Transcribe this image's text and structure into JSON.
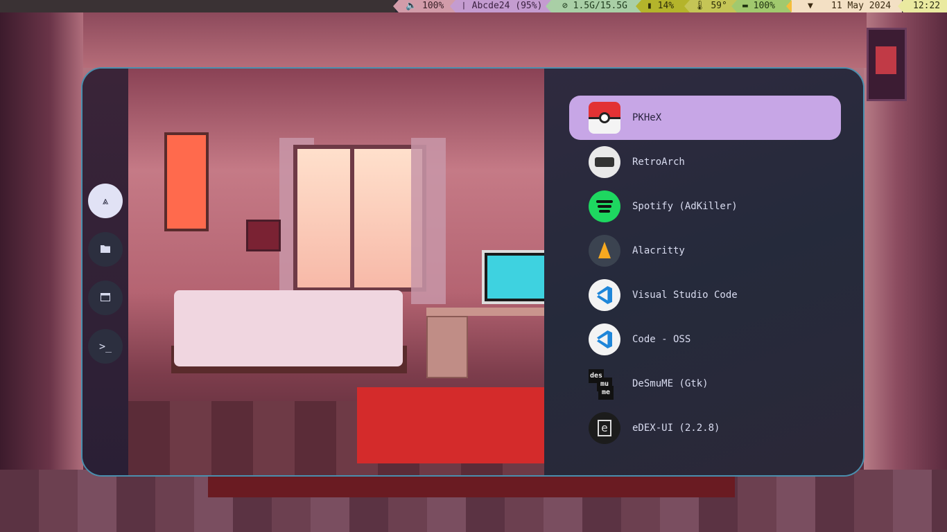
{
  "statusbar": {
    "volume": "🔈 100%",
    "wifi": "❘ Abcde24 (95%)",
    "memory": "⊘ 1.5G/15.5G",
    "cpu": "▮ 14%",
    "temperature": "🌡 59°",
    "battery": "▬ 100%",
    "network_icon": "▼",
    "date": "11 May 2024",
    "time": "12:22"
  },
  "sidebar": {
    "items": [
      {
        "icon": "⩓",
        "name": "arch-logo-icon"
      },
      {
        "icon": "🗀",
        "name": "folder-icon"
      },
      {
        "icon": "▬",
        "name": "window-icon"
      },
      {
        "icon": ">_",
        "name": "terminal-icon"
      }
    ]
  },
  "apps": [
    {
      "label": "PKHeX",
      "selected": true
    },
    {
      "label": "RetroArch"
    },
    {
      "label": "Spotify (AdKiller)"
    },
    {
      "label": "Alacritty"
    },
    {
      "label": "Visual Studio Code"
    },
    {
      "label": "Code - OSS"
    },
    {
      "label": "DeSmuME (Gtk)"
    },
    {
      "label": "eDEX-UI (2.2.8)"
    }
  ],
  "desmume_tiles": [
    "des",
    "mu",
    "me"
  ],
  "edex_glyph": "e",
  "colors": {
    "accent": "#c7a6e6",
    "border": "#4a8fae",
    "panel": "#2b2739"
  }
}
